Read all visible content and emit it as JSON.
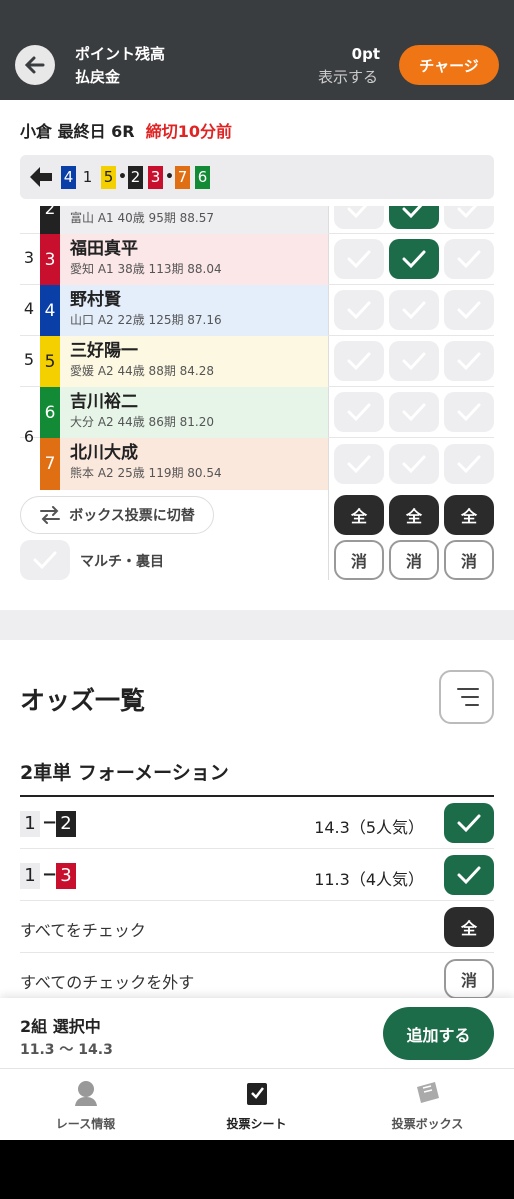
{
  "header": {
    "point_label": "ポイント残高",
    "refund_label": "払戻金",
    "points": "0pt",
    "show_label": "表示する",
    "charge_label": "チャージ"
  },
  "race": {
    "venue": "小倉 最終日 6R",
    "deadline": "締切10分前"
  },
  "combo": {
    "numbers": [
      "4",
      "1",
      "5",
      "2",
      "3",
      "7",
      "6"
    ],
    "separators": [
      "•",
      "•"
    ]
  },
  "riders": [
    {
      "waku": "2",
      "num": "2",
      "name": "",
      "detail": "富山 A1 40歳 95期 88.57",
      "checks": [
        false,
        true,
        false
      ]
    },
    {
      "waku": "3",
      "num": "3",
      "name": "福田真平",
      "detail": "愛知 A1 38歳 113期 88.04",
      "checks": [
        false,
        true,
        false
      ]
    },
    {
      "waku": "4",
      "num": "4",
      "name": "野村賢",
      "detail": "山口 A2 22歳 125期 87.16",
      "checks": [
        false,
        false,
        false
      ]
    },
    {
      "waku": "5",
      "num": "5",
      "name": "三好陽一",
      "detail": "愛媛 A2 44歳 88期 84.28",
      "checks": [
        false,
        false,
        false
      ]
    },
    {
      "waku": "6",
      "num": "6",
      "name": "吉川裕二",
      "detail": "大分 A2 44歳 86期 81.20",
      "checks": [
        false,
        false,
        false
      ]
    },
    {
      "waku": "",
      "num": "7",
      "name": "北川大成",
      "detail": "熊本 A2 25歳 119期 80.54",
      "checks": [
        false,
        false,
        false
      ]
    }
  ],
  "controls": {
    "box_switch": "ボックス投票に切替",
    "multi": "マルチ・裏目",
    "all": "全",
    "clear": "消"
  },
  "odds": {
    "title": "オッズ一覧",
    "formation": "2車単 フォーメーション",
    "rows": [
      {
        "first": "1",
        "second": "2",
        "odds": "14.3（5人気）"
      },
      {
        "first": "1",
        "second": "3",
        "odds": "11.3（4人気）"
      }
    ],
    "check_all": "すべてをチェック",
    "uncheck_all": "すべてのチェックを外す"
  },
  "footer": {
    "selected": "2組 選択中",
    "range": "11.3 〜 14.3",
    "add": "追加する"
  },
  "nav": {
    "items": [
      "レース情報",
      "投票シート",
      "投票ボックス"
    ]
  },
  "colors": {
    "1": "#ececef",
    "2": "#222222",
    "3": "#c8102e",
    "4": "#0b3fa8",
    "5": "#f5d000",
    "6": "#138a36",
    "7": "#e06f14",
    "accent": "#1c6b49",
    "charge": "#f07514"
  }
}
